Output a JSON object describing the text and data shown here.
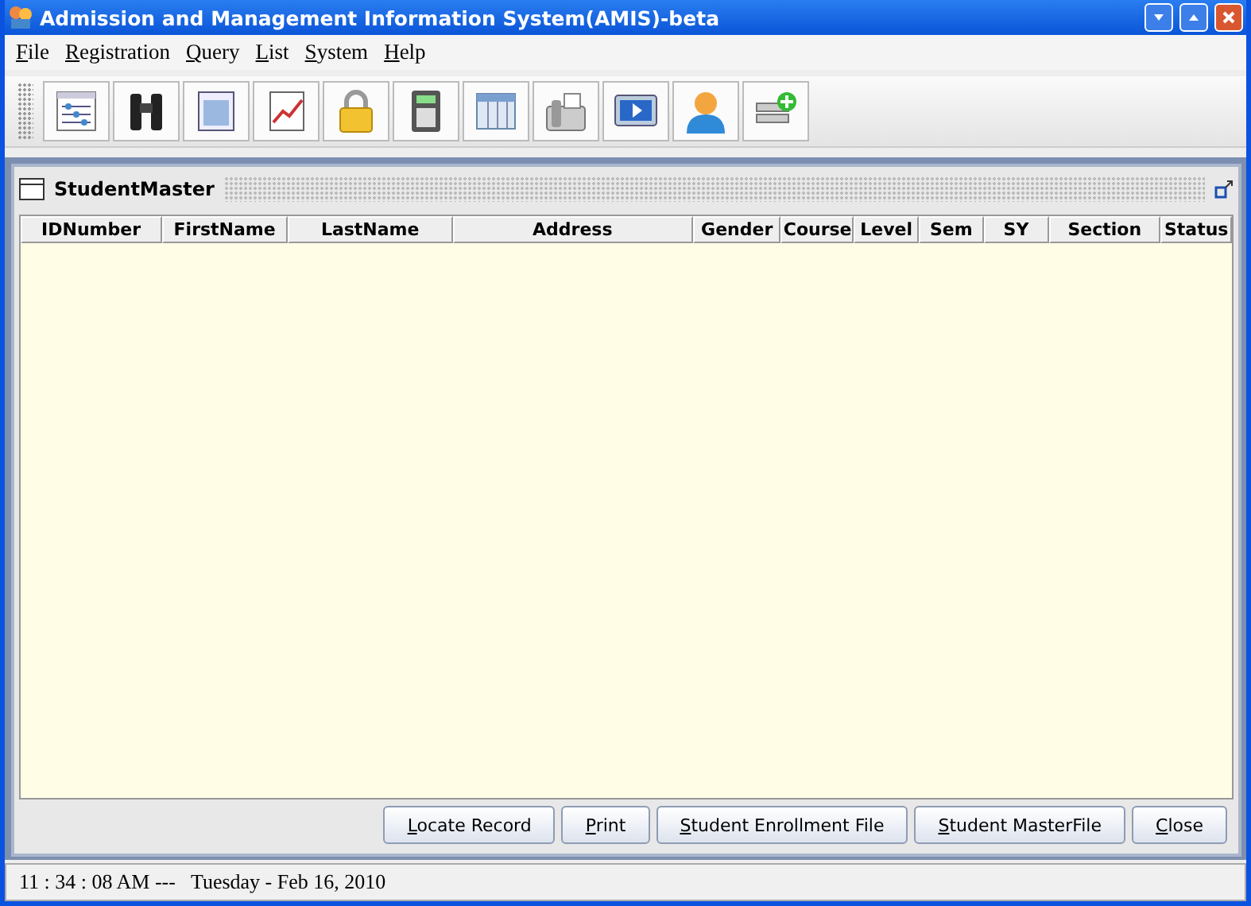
{
  "window": {
    "title": "Admission and Management Information System(AMIS)-beta"
  },
  "menu": [
    "File",
    "Registration",
    "Query",
    "List",
    "System",
    "Help"
  ],
  "toolbar": [
    {
      "kind": "sliders"
    },
    {
      "kind": "binoculars"
    },
    {
      "kind": "document"
    },
    {
      "kind": "chart"
    },
    {
      "kind": "lock"
    },
    {
      "kind": "calculator"
    },
    {
      "kind": "grid"
    },
    {
      "kind": "fax"
    },
    {
      "kind": "play"
    },
    {
      "kind": "user"
    },
    {
      "kind": "add"
    }
  ],
  "frame": {
    "title": "StudentMaster"
  },
  "table": {
    "columns": [
      "IDNumber",
      "FirstName",
      "LastName",
      "Address",
      "Gender",
      "Course",
      "Level",
      "Sem",
      "SY",
      "Section",
      "Status"
    ]
  },
  "buttons": [
    "Locate Record",
    "Print",
    "Student Enrollment File",
    "Student MasterFile",
    "Close"
  ],
  "status_bar": "11 : 34 : 08 AM ---   Tuesday - Feb 16, 2010"
}
